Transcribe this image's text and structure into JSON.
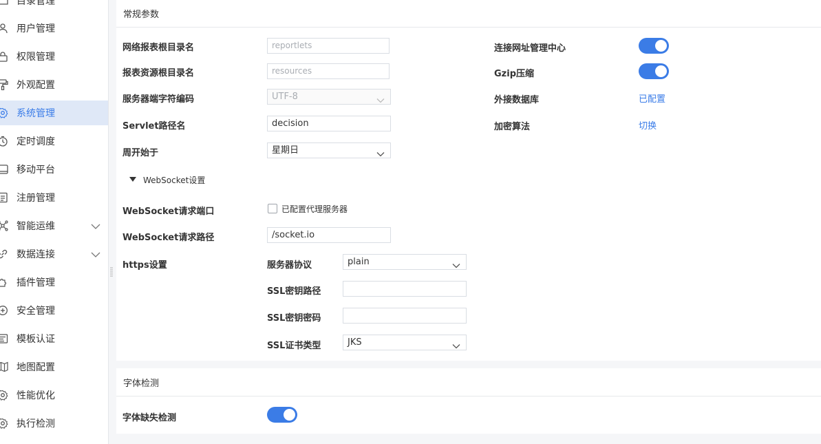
{
  "sidebar": {
    "items": [
      {
        "label": "目录管理",
        "icon": "folder-icon"
      },
      {
        "label": "用户管理",
        "icon": "user-icon"
      },
      {
        "label": "权限管理",
        "icon": "lock-icon"
      },
      {
        "label": "外观配置",
        "icon": "paint-roller-icon"
      },
      {
        "label": "系统管理",
        "icon": "gear-icon",
        "active": true
      },
      {
        "label": "定时调度",
        "icon": "clock-icon"
      },
      {
        "label": "移动平台",
        "icon": "mobile-icon"
      },
      {
        "label": "注册管理",
        "icon": "document-icon"
      },
      {
        "label": "智能运维",
        "icon": "network-icon",
        "expandable": true
      },
      {
        "label": "数据连接",
        "icon": "link-icon",
        "expandable": true
      },
      {
        "label": "插件管理",
        "icon": "puzzle-icon"
      },
      {
        "label": "安全管理",
        "icon": "shield-icon"
      },
      {
        "label": "模板认证",
        "icon": "template-icon"
      },
      {
        "label": "地图配置",
        "icon": "map-icon"
      },
      {
        "label": "性能优化",
        "icon": "gear-icon"
      },
      {
        "label": "执行检测",
        "icon": "gear-icon"
      }
    ]
  },
  "general": {
    "title": "常规参数",
    "report_root_label": "网络报表根目录名",
    "report_root_value": "reportlets",
    "resource_root_label": "报表资源根目录名",
    "resource_root_value": "resources",
    "charset_label": "服务器端字符编码",
    "charset_value": "UTF-8",
    "servlet_label": "Servlet路径名",
    "servlet_value": "decision",
    "week_start_label": "周开始于",
    "week_start_value": "星期日",
    "connect_center_label": "连接网址管理中心",
    "connect_center_on": true,
    "gzip_label": "Gzip压缩",
    "gzip_on": true,
    "external_db_label": "外接数据库",
    "external_db_value": "已配置",
    "encryption_label": "加密算法",
    "encryption_value": "切换",
    "websocket_section": "WebSocket设置",
    "ws_port_label": "WebSocket请求端口",
    "ws_proxy_label": "已配置代理服务器",
    "ws_proxy_checked": false,
    "ws_path_label": "WebSocket请求路径",
    "ws_path_value": "/socket.io",
    "https_label": "https设置",
    "protocol_label": "服务器协议",
    "protocol_value": "plain",
    "ssl_key_path_label": "SSL密钥路径",
    "ssl_key_path_value": "",
    "ssl_key_pwd_label": "SSL密钥密码",
    "ssl_key_pwd_value": "",
    "ssl_cert_type_label": "SSL证书类型",
    "ssl_cert_type_value": "JKS"
  },
  "font_check": {
    "title": "字体检测",
    "missing_label": "字体缺失检测",
    "missing_on": true
  },
  "colors": {
    "accent": "#3b7ce6",
    "active_bg": "#dfe8f7"
  }
}
